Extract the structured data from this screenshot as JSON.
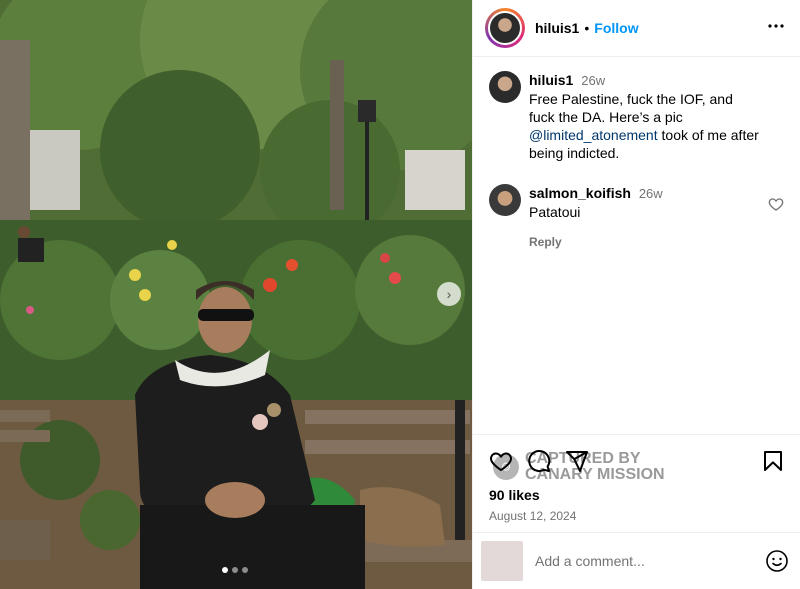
{
  "post": {
    "username": "hiluis1",
    "separator": "•",
    "follow_label": "Follow",
    "more_label": "•••"
  },
  "comments": [
    {
      "username": "hiluis1",
      "time": "26w",
      "text_before": "Free Palestine, fuck the IOF, and fuck the DA. Here’s a pic ",
      "mention": "@limited_atonement",
      "text_after": " took of me after being indicted."
    },
    {
      "username": "salmon_koifish",
      "time": "26w",
      "text": "Patatoui",
      "reply_label": "Reply"
    }
  ],
  "watermark": {
    "line1": "CAPTURED BY",
    "line2": "CANARY MISSION"
  },
  "likes": "90 likes",
  "date": "August 12, 2024",
  "add_comment": {
    "placeholder": "Add a comment..."
  },
  "carousel": {
    "total": 3,
    "active": 0
  },
  "icons": [
    "heart-icon",
    "comment-icon",
    "share-icon",
    "bookmark-icon",
    "emoji-icon",
    "chevron-right-icon"
  ],
  "colors": {
    "accent": "#0095f6",
    "mention": "#00376b",
    "muted": "#737373"
  }
}
